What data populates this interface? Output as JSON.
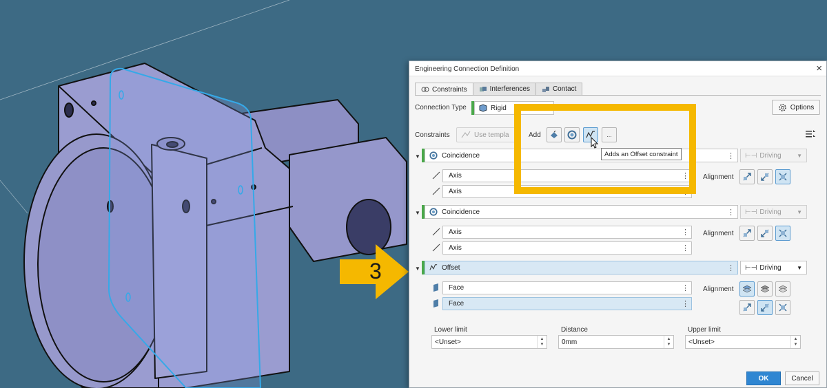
{
  "dialog": {
    "title": "Engineering Connection Definition",
    "close": "×",
    "tabs": [
      {
        "label": "Constraints",
        "active": true
      },
      {
        "label": "Interferences",
        "active": false
      },
      {
        "label": "Contact",
        "active": false
      }
    ],
    "connection_type_label": "Connection Type",
    "connection_type_value": "Rigid",
    "options_label": "Options",
    "constraints_label": "Constraints",
    "use_template_label": "Use templa",
    "add_label": "Add",
    "more_label": "...",
    "tooltip": "Adds an Offset constraint",
    "constraints": [
      {
        "name": "Coincidence",
        "mode": "Driving",
        "enabled": false,
        "subs": [
          "Axis",
          "Axis"
        ],
        "alignment_label": "Alignment"
      },
      {
        "name": "Coincidence",
        "mode": "Driving",
        "enabled": false,
        "subs": [
          "Axis",
          "Axis"
        ],
        "alignment_label": "Alignment"
      },
      {
        "name": "Offset",
        "mode": "Driving",
        "enabled": true,
        "subs": [
          "Face",
          "Face"
        ],
        "alignment_label": "Alignment"
      }
    ],
    "lower_limit_label": "Lower limit",
    "lower_limit_value": "<Unset>",
    "distance_label": "Distance",
    "distance_value": "0mm",
    "upper_limit_label": "Upper limit",
    "upper_limit_value": "<Unset>",
    "ok_label": "OK",
    "cancel_label": "Cancel"
  },
  "annotation": {
    "step_number": "3",
    "highlight_color": "#f5b800"
  },
  "colors": {
    "background": "#3d6a84",
    "accent": "#2f86d2",
    "part": "#9a9cd0",
    "selection_edge": "#35a9e8"
  }
}
